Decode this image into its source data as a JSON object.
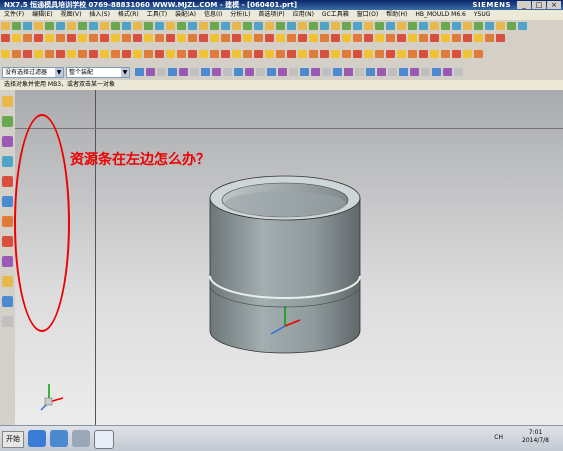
{
  "window": {
    "title": "NX7.5  恒通模具培训学校    0769-88831060  WWW.MJZL.COM - 建模 - [060401.prt]",
    "brand": "SIEMENS",
    "controls": [
      "_",
      "□",
      "×"
    ]
  },
  "menu": [
    "文件(F)",
    "编辑(E)",
    "视图(V)",
    "插入(S)",
    "格式(R)",
    "工具(T)",
    "装配(A)",
    "信息(I)",
    "分析(L)",
    "首选项(P)",
    "应用(N)",
    "GC工具箱",
    "窗口(O)",
    "帮助(H)",
    "HB_MOULD M6.6",
    "YSUG"
  ],
  "toolbar": {
    "filter_value": "没有选择过滤器",
    "assembly_value": "整个装配"
  },
  "cue_line": "选择对象并使用 MB3，或者双击某一对象",
  "annotation": {
    "question": "资源条在左边怎么办？"
  },
  "taskbar": {
    "start_label": "开始",
    "tray_text": "CH",
    "clock_time": "7:01",
    "clock_date": "2014/7/8"
  },
  "colors": {
    "annotation": "#e00000",
    "title_bar": "#0a246a",
    "part_fill": "#8f9a9c"
  }
}
